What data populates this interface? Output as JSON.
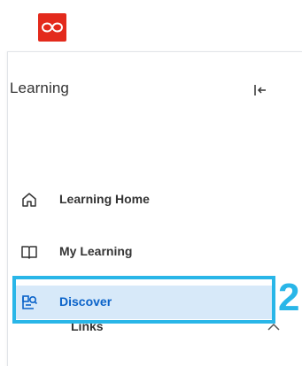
{
  "app": {
    "logo_icon": "infinity-logo-icon",
    "brand_color": "#e32a1c"
  },
  "sidebar": {
    "title": "Learning",
    "collapse_icon": "collapse-left-icon",
    "items": [
      {
        "label": "Learning Home",
        "icon": "home-icon",
        "active": false
      },
      {
        "label": "My Learning",
        "icon": "book-icon",
        "active": false
      },
      {
        "label": "Discover",
        "icon": "discover-icon",
        "active": true
      }
    ],
    "links_section": {
      "label": "Links",
      "expanded": true,
      "icon": "chevron-up-icon"
    }
  },
  "annotation": {
    "step_number": "2",
    "highlight_color": "#29b6e8"
  },
  "colors": {
    "active_bg": "#d7e9f9",
    "active_text": "#0b63c9",
    "text": "#333333"
  }
}
